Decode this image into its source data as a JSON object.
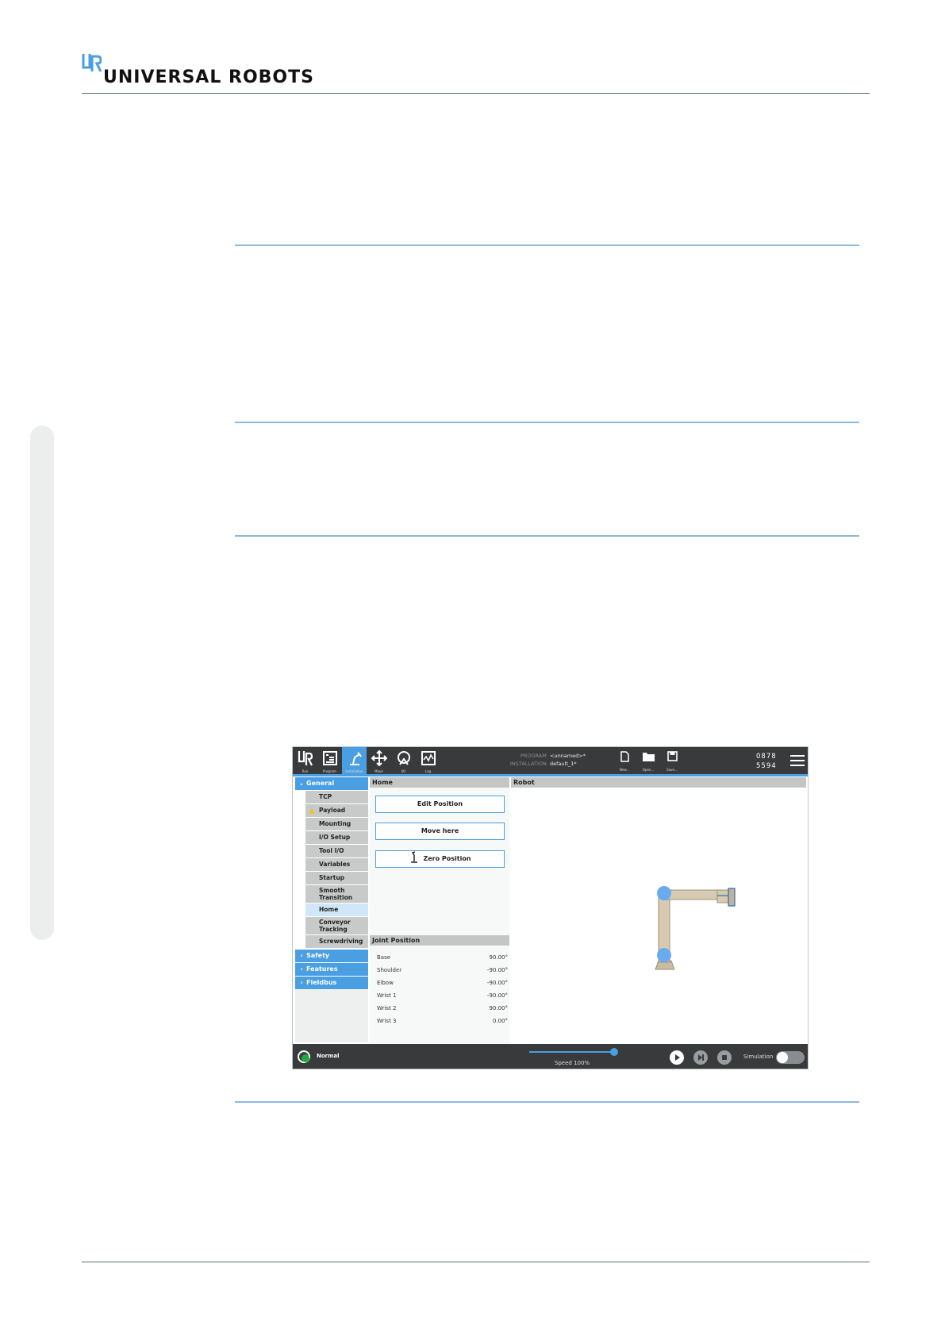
{
  "header": {
    "brand": "UNIVERSAL ROBOTS"
  },
  "screenshot": {
    "nav": [
      {
        "label": "Run",
        "icon": "ur-logo-icon"
      },
      {
        "label": "Program",
        "icon": "program-icon"
      },
      {
        "label": "Installation",
        "icon": "installation-icon",
        "active": true
      },
      {
        "label": "Move",
        "icon": "move-icon"
      },
      {
        "label": "I/O",
        "icon": "io-icon"
      },
      {
        "label": "Log",
        "icon": "log-icon"
      }
    ],
    "program_key": "PROGRAM",
    "program_value": "<unnamed>*",
    "installation_key": "INSTALLATION",
    "installation_value": "default_1*",
    "file_buttons": [
      {
        "label": "New...",
        "icon": "new-file-icon"
      },
      {
        "label": "Open...",
        "icon": "open-folder-icon"
      },
      {
        "label": "Save...",
        "icon": "save-icon"
      }
    ],
    "serial_line1": "0878",
    "serial_line2": "5594",
    "menu": {
      "general": "General",
      "items": [
        "TCP",
        "Payload",
        "Mounting",
        "I/O Setup",
        "Tool I/O",
        "Variables",
        "Startup",
        "Smooth\nTransition",
        "Home",
        "Conveyor\nTracking",
        "Screwdriving"
      ],
      "safety": "Safety",
      "features": "Features",
      "fieldbus": "Fieldbus"
    },
    "home_panel_title": "Home",
    "robot_panel_title": "Robot",
    "buttons": {
      "edit_position": "Edit Position",
      "move_here": "Move here",
      "zero_position": "Zero Position"
    },
    "joint_position_title": "Joint Position",
    "joints": [
      {
        "name": "Base",
        "value": "90.00°"
      },
      {
        "name": "Shoulder",
        "value": "-90.00°"
      },
      {
        "name": "Elbow",
        "value": "-90.00°"
      },
      {
        "name": "Wrist 1",
        "value": "-90.00°"
      },
      {
        "name": "Wrist 2",
        "value": "90.00°"
      },
      {
        "name": "Wrist 3",
        "value": "0.00°"
      }
    ],
    "status": "Normal",
    "speed": "Speed 100%",
    "speed_fraction": 1.0,
    "simulation": "Simulation",
    "colors": {
      "accent": "#4a9ee2",
      "bar": "#383a3c",
      "status_ok": "#1faa3f",
      "warning": "#e8c43a"
    }
  }
}
